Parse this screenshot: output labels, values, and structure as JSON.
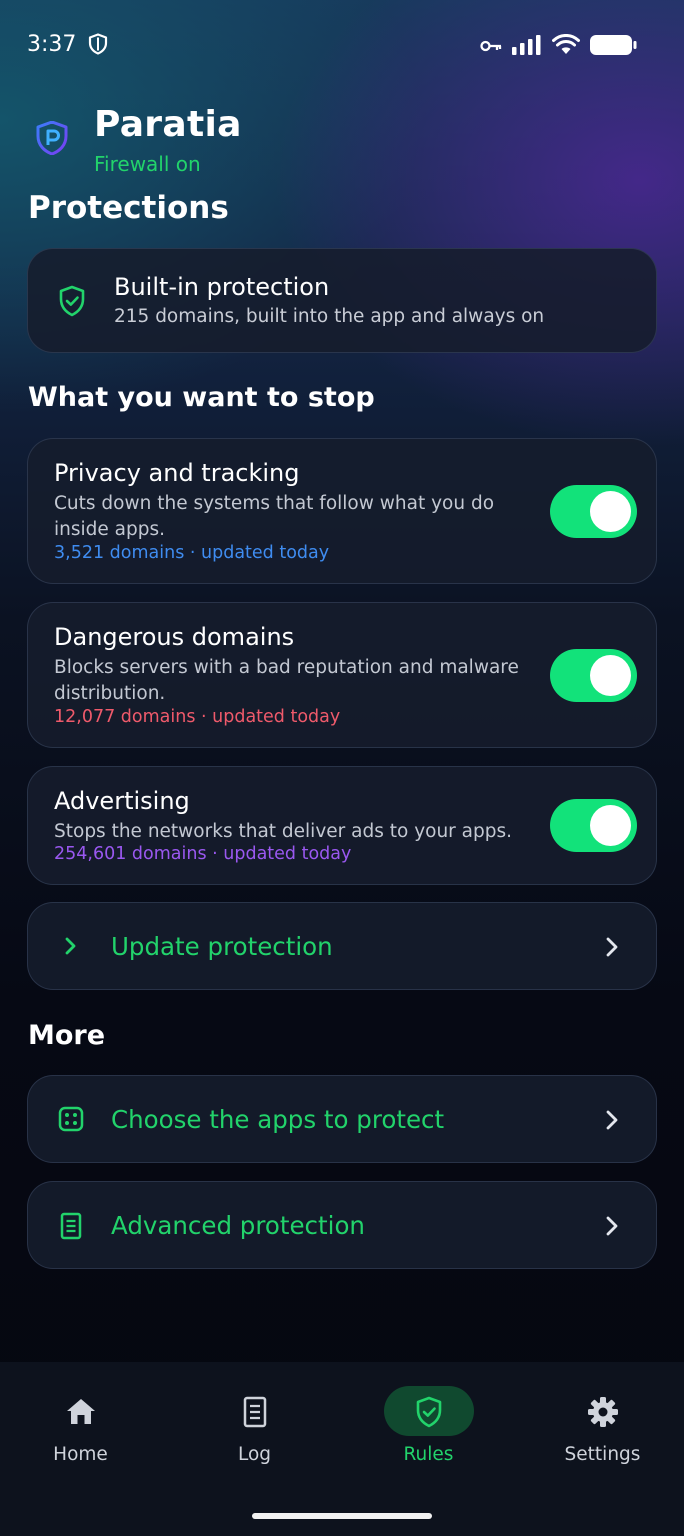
{
  "status_bar": {
    "time": "3:37",
    "icons": [
      "shield-icon",
      "key-icon",
      "signal-icon",
      "wifi-icon",
      "battery-icon"
    ]
  },
  "header": {
    "app_name": "Paratia",
    "firewall_status": "Firewall on"
  },
  "protections": {
    "title": "Protections",
    "builtin": {
      "title": "Built-in protection",
      "subtitle": "215 domains, built into the app and always on",
      "icon": "shield-check-icon"
    }
  },
  "stop_section": {
    "title": "What you want to stop",
    "items": [
      {
        "title": "Privacy and tracking",
        "description": "Cuts down the systems that follow what you do inside apps.",
        "meta": "3,521 domains · updated today",
        "meta_color": "#3f8cf0",
        "enabled": true
      },
      {
        "title": "Dangerous domains",
        "description": "Blocks servers with a bad reputation and malware distribution.",
        "meta": "12,077 domains · updated today",
        "meta_color": "#ef5a6b",
        "enabled": true
      },
      {
        "title": "Advertising",
        "description": "Stops the networks that deliver ads to your apps.",
        "meta": "254,601 domains · updated today",
        "meta_color": "#9a58f0",
        "enabled": true
      }
    ],
    "update_label": "Update protection"
  },
  "more": {
    "title": "More",
    "items": [
      {
        "label": "Choose the apps to protect",
        "icon": "apps-grid-icon"
      },
      {
        "label": "Advanced protection",
        "icon": "document-icon"
      }
    ]
  },
  "bottom_nav": {
    "items": [
      {
        "label": "Home",
        "icon": "home-icon"
      },
      {
        "label": "Log",
        "icon": "log-icon"
      },
      {
        "label": "Rules",
        "icon": "shield-check-icon",
        "active": true
      },
      {
        "label": "Settings",
        "icon": "gear-icon"
      }
    ]
  },
  "colors": {
    "accent_green": "#22d36b",
    "toggle_on": "#12e27a",
    "card_bg": "#161c2c"
  }
}
